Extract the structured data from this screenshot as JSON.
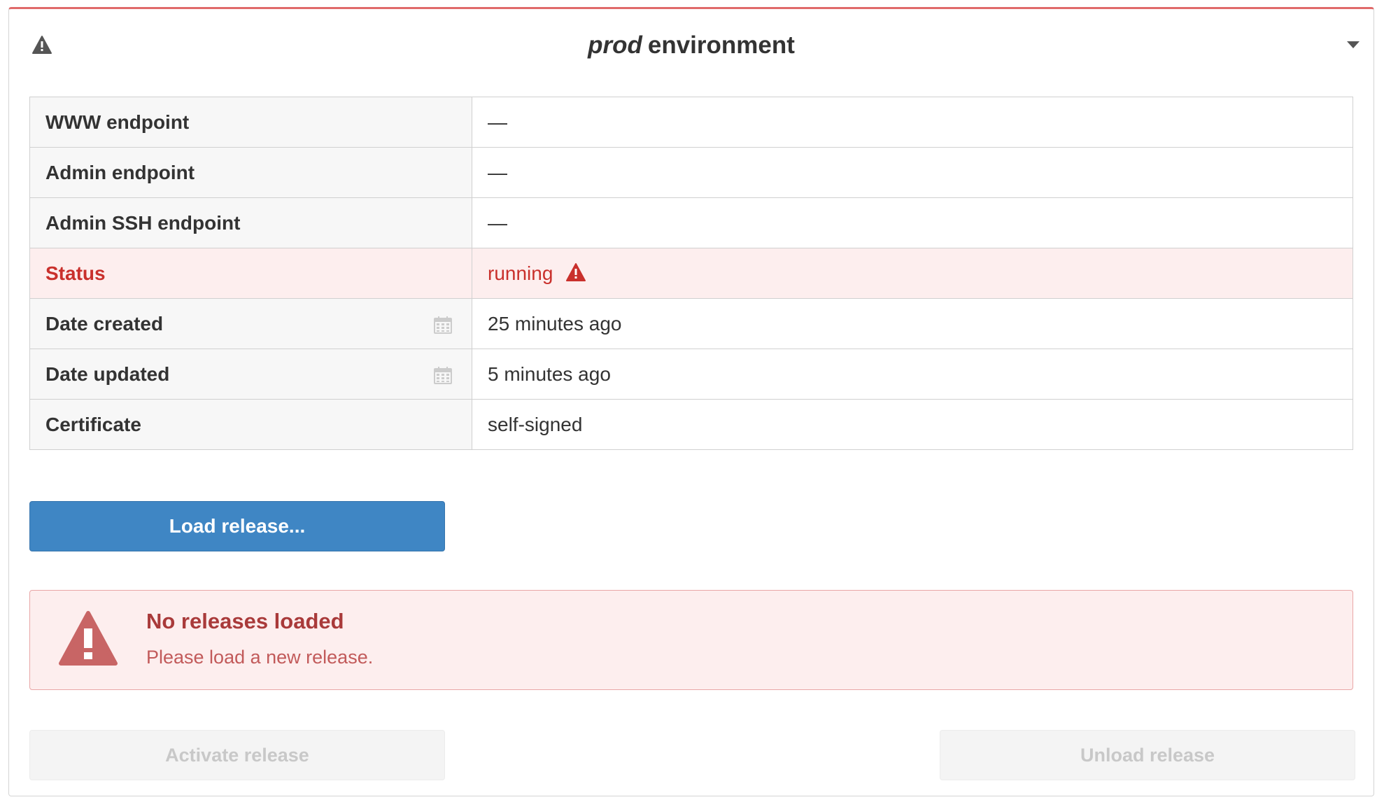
{
  "header": {
    "env_name": "prod",
    "env_suffix": "environment",
    "warning_icon": "warning-triangle-icon",
    "toggle_icon": "caret-down-icon"
  },
  "details": {
    "rows": [
      {
        "label": "WWW endpoint",
        "value": "—"
      },
      {
        "label": "Admin endpoint",
        "value": "—"
      },
      {
        "label": "Admin SSH endpoint",
        "value": "—"
      },
      {
        "label": "Status",
        "value": "running"
      },
      {
        "label": "Date created",
        "value": "25 minutes ago"
      },
      {
        "label": "Date updated",
        "value": "5 minutes ago"
      },
      {
        "label": "Certificate",
        "value": "self-signed"
      }
    ]
  },
  "actions": {
    "load_label": "Load release...",
    "activate_label": "Activate release",
    "unload_label": "Unload release"
  },
  "alert": {
    "title": "No releases loaded",
    "message": "Please load a new release."
  },
  "colors": {
    "primary": "#3f86c4",
    "danger_text": "#c9302c",
    "danger_bg": "#fdeeee",
    "alert_icon": "#c86565"
  }
}
